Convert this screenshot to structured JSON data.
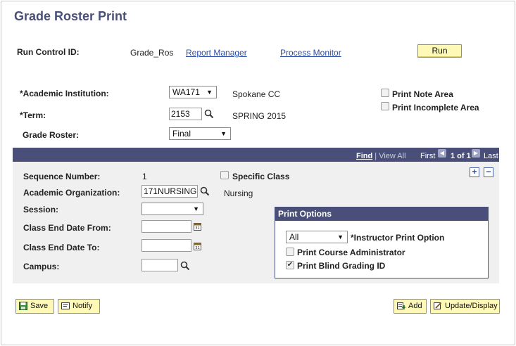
{
  "page": {
    "title": "Grade Roster Print"
  },
  "header": {
    "run_control_label": "Run Control ID:",
    "run_control_value": "Grade_Ros",
    "report_manager": "Report Manager",
    "process_monitor": "Process Monitor",
    "run_button": "Run"
  },
  "form": {
    "institution_label": "*Academic Institution:",
    "institution_value": "WA171",
    "institution_desc": "Spokane CC",
    "term_label": "*Term:",
    "term_value": "2153",
    "term_desc": "SPRING 2015",
    "grade_roster_label": "Grade Roster:",
    "grade_roster_value": "Final",
    "print_note_area": "Print Note Area",
    "print_incomplete_area": "Print Incomplete Area"
  },
  "grid": {
    "find": "Find",
    "view_all": "View All",
    "first": "First",
    "count": "1 of 1",
    "last": "Last",
    "sequence_label": "Sequence Number:",
    "sequence_value": "1",
    "specific_class": "Specific Class",
    "org_label": "Academic Organization:",
    "org_value": "171NURSING",
    "org_desc": "Nursing",
    "session_label": "Session:",
    "session_value": "",
    "end_from_label": "Class End Date From:",
    "end_to_label": "Class End Date To:",
    "campus_label": "Campus:"
  },
  "print_options": {
    "title": "Print Options",
    "instructor_option_value": "All",
    "instructor_option_label": "*Instructor Print Option",
    "course_admin": "Print Course Administrator",
    "blind_grading": "Print Blind Grading ID",
    "blind_grading_checked": true
  },
  "footer": {
    "save": "Save",
    "notify": "Notify",
    "add": "Add",
    "update_display": "Update/Display"
  }
}
